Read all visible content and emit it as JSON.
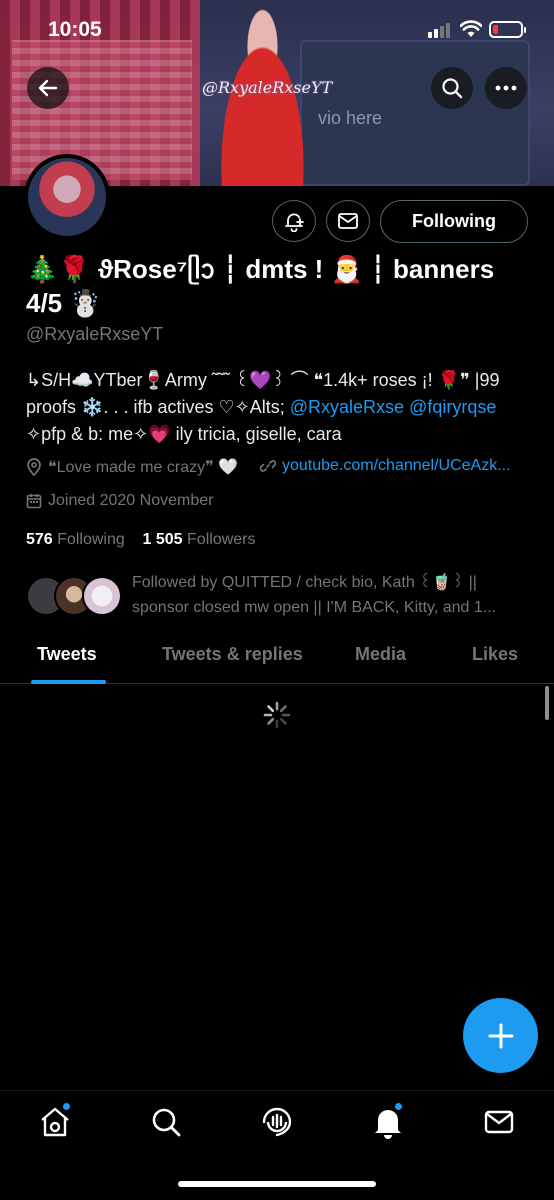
{
  "status_bar": {
    "time": "10:05"
  },
  "banner": {
    "watermark": "@RxyaleRxseYT",
    "screen_text": "vio  here"
  },
  "profile": {
    "display_name": "🎄🌹 ϑRose⁷ᥫᩣ ┆ dmts ! 🎅 ┆ banners 4/5 ☃️",
    "handle": "@RxyaleRxseYT",
    "follow_button": "Following",
    "bio": {
      "text1": "↳S/H☁️YTber🍷Army ˜˜˜ ꒰💜꒱ ⌒ ❝1.4k+ roses ¡! 🌹❞ |99 proofs ❄️. . . ifb actives ♡✧Alts; ",
      "mention1": "@RxyaleRxse",
      "mention2": "@fqiryrqse",
      "text2": "✧pfp & b: me✧💗 ily tricia, giselle, cara"
    },
    "location": "❝Love made me crazy❞ 🤍",
    "website": "youtube.com/channel/UCeAzk...",
    "joined": "Joined 2020 November",
    "following_count": "576",
    "following_label": "Following",
    "followers_count": "1 505",
    "followers_label": "Followers",
    "followed_by": "Followed by QUITTED / check bio, Kath ꒰🧋꒱ || sponsor closed mw open || I'M BACK, Kitty, and 1..."
  },
  "tabs": [
    {
      "label": "Tweets",
      "active": true
    },
    {
      "label": "Tweets & replies",
      "active": false
    },
    {
      "label": "Media",
      "active": false
    },
    {
      "label": "Likes",
      "active": false
    }
  ],
  "bottom_nav": [
    "home-icon",
    "search-icon",
    "spaces-icon",
    "notifications-icon",
    "messages-icon"
  ],
  "colors": {
    "accent": "#1d9bf0",
    "background": "#000000",
    "muted": "#71767b"
  }
}
